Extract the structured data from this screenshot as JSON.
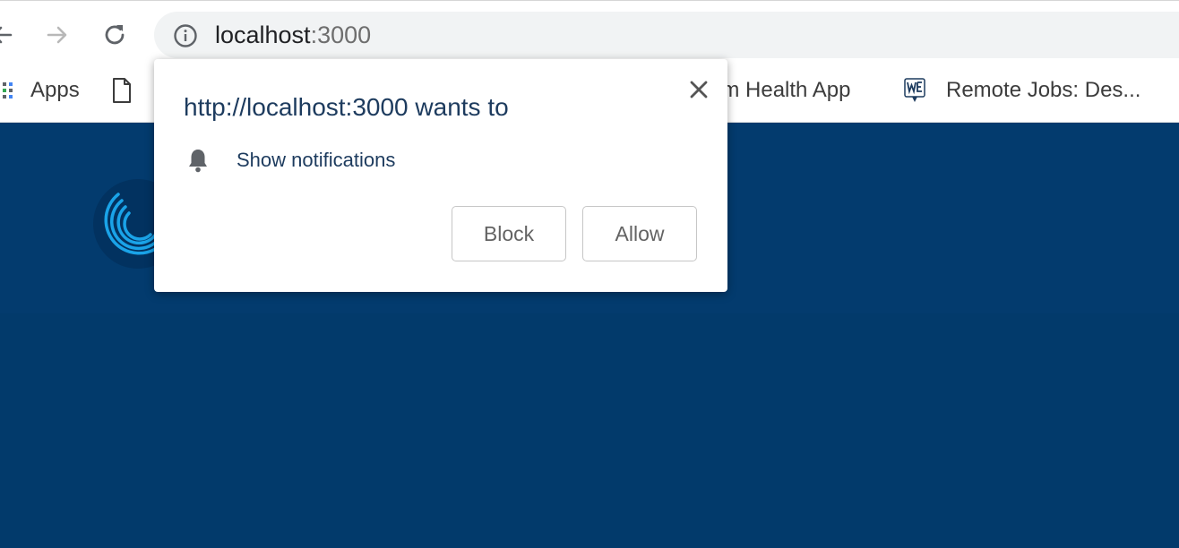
{
  "browser": {
    "url_host": "localhost",
    "url_port": ":3000",
    "icons": [
      "back-arrow-icon",
      "forward-arrow-icon",
      "reload-icon",
      "info-icon"
    ]
  },
  "bookmarks": {
    "apps_label": "Apps",
    "items": [
      {
        "label": "em Health App",
        "icon": "document-icon"
      },
      {
        "label": "Remote Jobs: Des...",
        "icon": "we-logo-icon"
      }
    ]
  },
  "popup": {
    "title": "http://localhost:3000 wants to",
    "permission_label": "Show notifications",
    "block_label": "Block",
    "allow_label": "Allow",
    "icons": [
      "close-icon",
      "bell-icon"
    ]
  },
  "colors": {
    "page_background": "#023a6b",
    "hero_background": "#033b6e",
    "logo_accent": "#1aa3e8",
    "popup_text": "#1d3b5e"
  }
}
